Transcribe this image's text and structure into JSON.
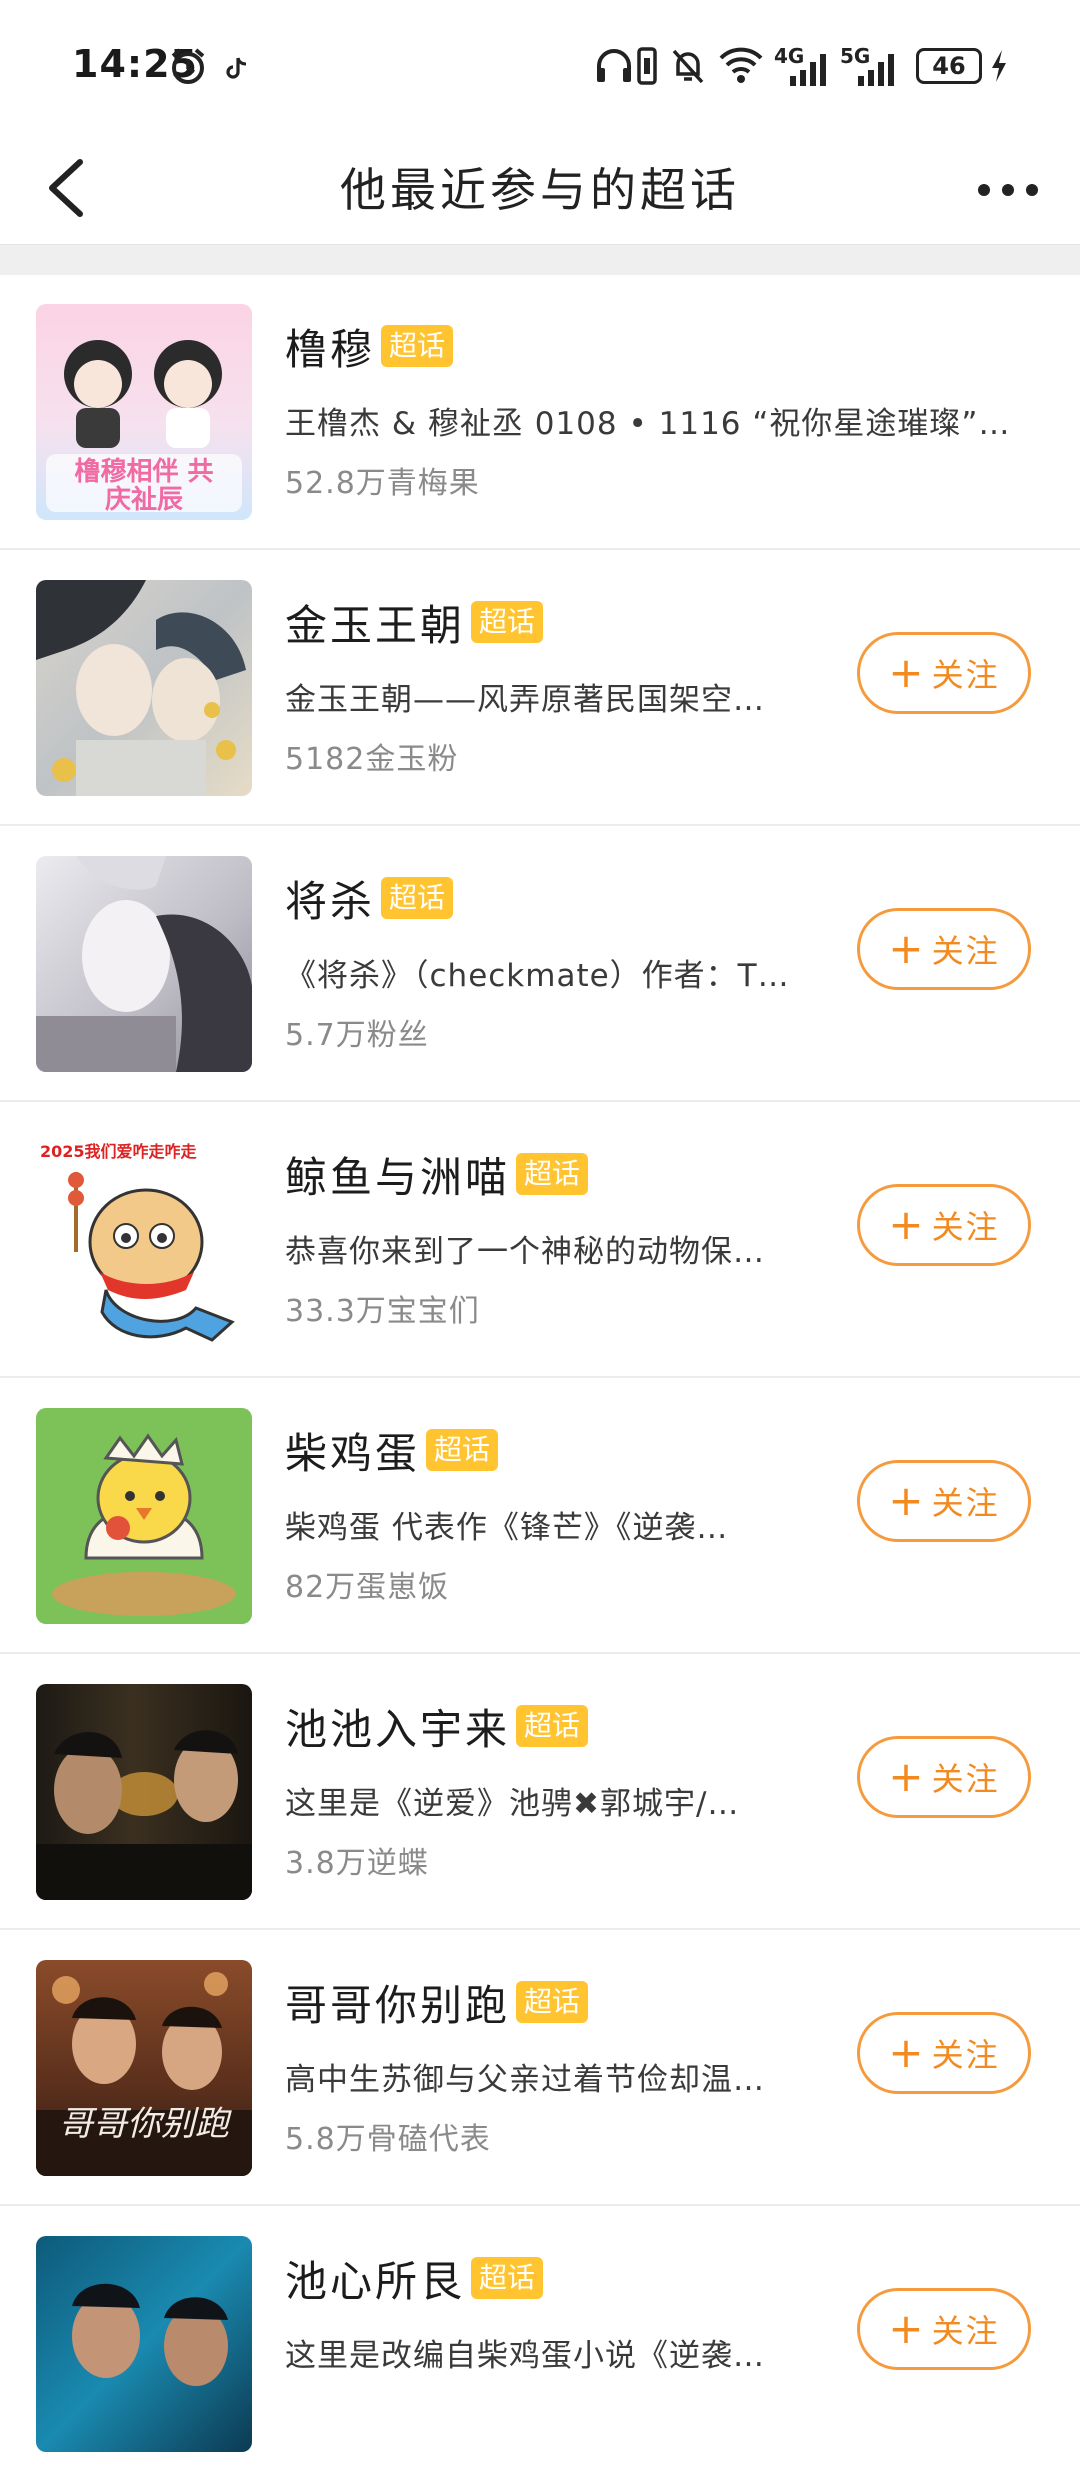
{
  "status": {
    "time": "14:25",
    "network_4g": "4G",
    "network_5g": "5G",
    "battery": "46"
  },
  "header": {
    "title": "他最近参与的超话"
  },
  "badge_label": "超话",
  "follow_label": "关注",
  "items": [
    {
      "name": "橹穆",
      "desc": "王橹杰 & 穆祉丞 0108 • 1116 “祝你星途璀璨”…",
      "count": "52.8万青梅果",
      "followable": false
    },
    {
      "name": "金玉王朝",
      "desc": "金玉王朝——风弄原著民国架空…",
      "count": "5182金玉粉",
      "followable": true
    },
    {
      "name": "将杀",
      "desc": "《将杀》（checkmate）作者：T…",
      "count": "5.7万粉丝",
      "followable": true
    },
    {
      "name": "鲸鱼与洲喵",
      "desc": "恭喜你来到了一个神秘的动物保…",
      "count": "33.3万宝宝们",
      "followable": true
    },
    {
      "name": "柴鸡蛋",
      "desc": "柴鸡蛋 代表作《锋芒》《逆袭…",
      "count": "82万蛋崽饭",
      "followable": true
    },
    {
      "name": "池池入宇来",
      "desc": "这里是《逆爱》池骋✖郭城宇/…",
      "count": "3.8万逆蝶",
      "followable": true
    },
    {
      "name": "哥哥你别跑",
      "desc": "高中生苏御与父亲过着节俭却温…",
      "count": "5.8万骨磕代表",
      "followable": true
    },
    {
      "name": "池心所艮",
      "desc": "这里是改编自柴鸡蛋小说《逆袭…",
      "count": "",
      "followable": true
    }
  ],
  "thumb_text": {
    "item1": "橹穆相伴 共庆祉辰",
    "item4": "2025我们爱咋走咋走",
    "item7": "哥哥你别跑"
  },
  "colors": {
    "accent": "#f59a3d",
    "badge": "#ffc430"
  }
}
